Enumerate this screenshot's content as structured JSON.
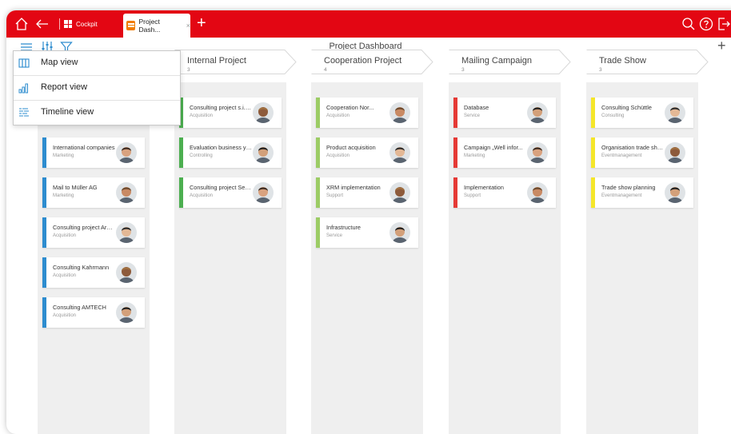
{
  "topbar": {
    "cockpit_label": "Cockpit",
    "active_tab_label": "Project Dash...",
    "tab_close": "×",
    "new_tab": "+"
  },
  "subbar": {
    "page_title": "Project Dashboard",
    "add": "+"
  },
  "view_menu": {
    "items": [
      {
        "label": "Map view",
        "icon": "map-view-icon"
      },
      {
        "label": "Report view",
        "icon": "report-view-icon"
      },
      {
        "label": "Timeline view",
        "icon": "timeline-view-icon"
      }
    ]
  },
  "colors": {
    "brand_red": "#e30613",
    "blue": "#2d8ccf",
    "green": "#4caf50",
    "lime": "#9ccc65",
    "red": "#e53935",
    "yellow": "#f5e62a"
  },
  "columns": [
    {
      "title": "",
      "count": "",
      "cards": [
        {
          "title": "International companies",
          "subtitle": "Marketing",
          "color": "#2d8ccf",
          "avatar": "person-avatar"
        },
        {
          "title": "Mail to Müller AG",
          "subtitle": "Marketing",
          "color": "#2d8ccf",
          "avatar": "person-avatar"
        },
        {
          "title": "Consulting project Argus",
          "subtitle": "Acquisition",
          "color": "#2d8ccf",
          "avatar": "person-avatar"
        },
        {
          "title": "Consulting Kahrmann",
          "subtitle": "Acquisition",
          "color": "#2d8ccf",
          "avatar": "person-avatar"
        },
        {
          "title": "Consulting AMTECH",
          "subtitle": "Acquisition",
          "color": "#2d8ccf",
          "avatar": "person-avatar"
        }
      ]
    },
    {
      "title": "Internal Project",
      "count": "3",
      "cards": [
        {
          "title": "Consulting project s.i.g...",
          "subtitle": "Acquisition",
          "color": "#4caf50",
          "avatar": "person-avatar"
        },
        {
          "title": "Evaluation business year",
          "subtitle": "Controlling",
          "color": "#4caf50",
          "avatar": "person-avatar"
        },
        {
          "title": "Consulting project Secu...",
          "subtitle": "Acquisition",
          "color": "#4caf50",
          "avatar": "person-avatar"
        }
      ]
    },
    {
      "title": "Cooperation Project",
      "count": "4",
      "cards": [
        {
          "title": "Cooperation Nor...",
          "subtitle": "Acquisition",
          "color": "#9ccc65",
          "avatar": "person-avatar"
        },
        {
          "title": "Product acquisition",
          "subtitle": "Acquisition",
          "color": "#9ccc65",
          "avatar": "person-avatar"
        },
        {
          "title": "XRM implementation",
          "subtitle": "Support",
          "color": "#9ccc65",
          "avatar": "person-avatar"
        },
        {
          "title": "Infrastructure",
          "subtitle": "Service",
          "color": "#9ccc65",
          "avatar": "person-avatar"
        }
      ]
    },
    {
      "title": "Mailing Campaign",
      "count": "3",
      "cards": [
        {
          "title": "Database",
          "subtitle": "Service",
          "color": "#e53935",
          "avatar": "person-avatar"
        },
        {
          "title": "Campaign „Well infor...",
          "subtitle": "Marketing",
          "color": "#e53935",
          "avatar": "person-avatar"
        },
        {
          "title": "Implementation",
          "subtitle": "Support",
          "color": "#e53935",
          "avatar": "person-avatar"
        }
      ]
    },
    {
      "title": "Trade Show",
      "count": "3",
      "cards": [
        {
          "title": "Consulting Schüttle",
          "subtitle": "Consulting",
          "color": "#f5e62a",
          "avatar": "person-avatar"
        },
        {
          "title": "Organisation trade show",
          "subtitle": "Eventmanagement",
          "color": "#f5e62a",
          "avatar": "person-avatar"
        },
        {
          "title": "Trade show planning",
          "subtitle": "Eventmanagement",
          "color": "#f5e62a",
          "avatar": "person-avatar"
        }
      ]
    }
  ]
}
